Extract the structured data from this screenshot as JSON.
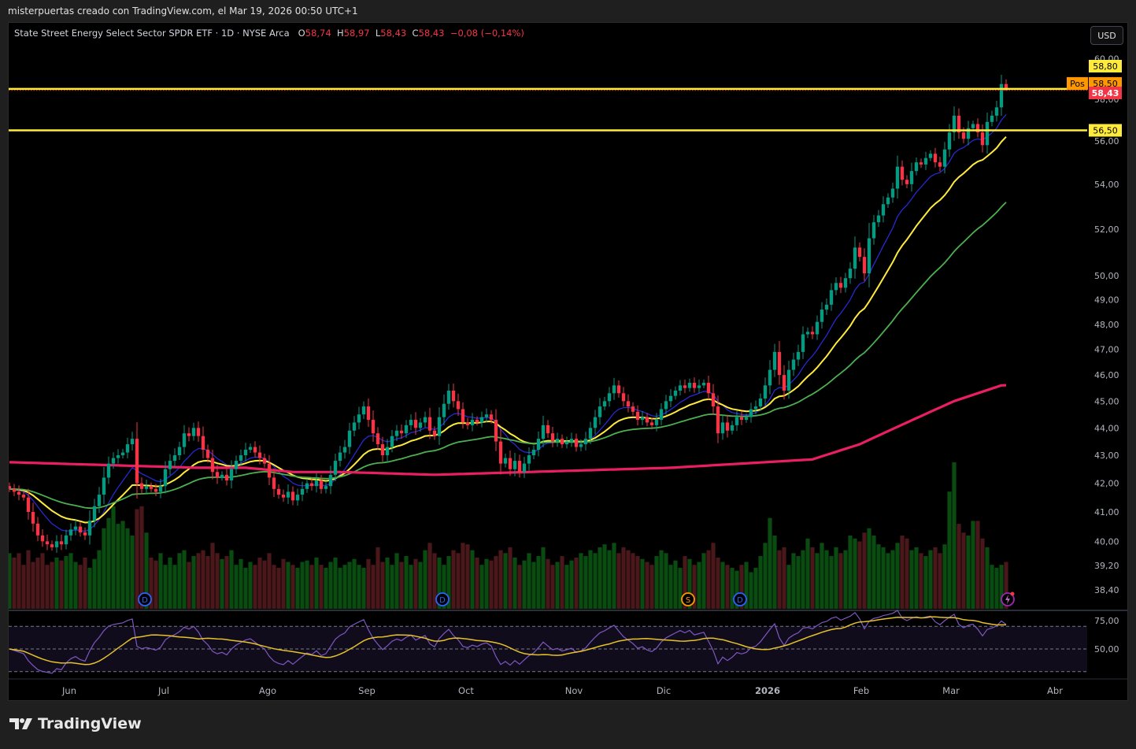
{
  "header": {
    "attribution": "misterpuertas creado con TradingView.com, el Mar 19, 2026 00:50 UTC+1"
  },
  "legend": {
    "symbol": "State Street Energy Select Sector SPDR ETF · 1D · NYSE Arca",
    "open_label": "O",
    "open": "58,74",
    "high_label": "H",
    "high": "58,97",
    "low_label": "L",
    "low": "58,43",
    "close_label": "C",
    "close": "58,43",
    "change": "−0,08 (−0,14%)"
  },
  "currency_button": "USD",
  "footer": {
    "brand": "TradingView"
  },
  "colors": {
    "up": "#089981",
    "down": "#f23645",
    "volume_up": "#0a4b12",
    "volume_down": "#4a171b",
    "ma_fast": "#2a2ae0",
    "ma_mid": "#ffeb3b",
    "ma_slow": "#4caf50",
    "ma_long": "#e91e63",
    "rsi": "#7e57c2",
    "rsi_ma": "#e6c229",
    "hline": "#ffeb3b",
    "position": "#ff9800"
  },
  "chart_data": {
    "type": "candlestick",
    "scale": "log",
    "interval": "1D",
    "x_tick_labels": [
      "Jun",
      "Jul",
      "Ago",
      "Sep",
      "Oct",
      "Nov",
      "Dic",
      "2026",
      "Feb",
      "Mar",
      "Abr"
    ],
    "y_tick_labels": [
      "60,00",
      "58,00",
      "56,00",
      "54,00",
      "52,00",
      "50,00",
      "49,00",
      "48,00",
      "47,00",
      "46,00",
      "45,00",
      "44,00",
      "43,00",
      "42,00",
      "41,00",
      "40,00",
      "39,20",
      "38,40"
    ],
    "y_ticks": [
      60,
      58,
      56,
      54,
      52,
      50,
      49,
      48,
      47,
      46,
      45,
      44,
      43,
      42,
      41,
      40,
      39.2,
      38.4
    ],
    "ylim": [
      38.4,
      60.5
    ],
    "last_candle": {
      "open": 58.74,
      "high": 58.97,
      "low": 58.43,
      "close": 58.43
    },
    "close": [
      41.8,
      41.7,
      41.6,
      41.5,
      41.0,
      40.6,
      40.2,
      40.0,
      39.9,
      39.8,
      40.0,
      39.9,
      40.2,
      40.4,
      40.5,
      40.3,
      40.2,
      40.7,
      41.2,
      41.6,
      42.2,
      42.7,
      42.9,
      43.0,
      43.1,
      43.4,
      43.6,
      42.0,
      41.8,
      41.9,
      41.8,
      41.7,
      41.9,
      42.5,
      42.8,
      43.0,
      43.3,
      43.8,
      43.7,
      44.0,
      43.7,
      43.2,
      42.9,
      42.4,
      42.2,
      42.3,
      42.1,
      42.5,
      42.8,
      43.0,
      43.2,
      43.3,
      43.1,
      42.9,
      42.7,
      42.2,
      41.8,
      41.6,
      41.5,
      41.7,
      41.4,
      41.6,
      41.8,
      42.0,
      41.9,
      42.1,
      41.8,
      41.9,
      42.3,
      42.8,
      43.1,
      43.3,
      43.9,
      44.2,
      44.5,
      44.8,
      44.3,
      43.8,
      43.4,
      43.0,
      43.3,
      43.7,
      43.9,
      43.8,
      44.1,
      44.3,
      44.0,
      44.2,
      44.4,
      43.9,
      43.7,
      44.4,
      44.9,
      45.4,
      45.0,
      44.7,
      44.2,
      44.1,
      44.3,
      44.2,
      44.4,
      44.5,
      44.3,
      43.5,
      42.7,
      42.9,
      42.5,
      42.8,
      42.4,
      42.7,
      43.0,
      43.2,
      43.6,
      44.1,
      43.8,
      43.5,
      43.6,
      43.4,
      43.5,
      43.6,
      43.3,
      43.4,
      43.6,
      44.0,
      44.4,
      44.8,
      45.0,
      45.3,
      45.6,
      45.3,
      45.0,
      44.8,
      44.6,
      44.3,
      44.4,
      44.2,
      44.1,
      44.3,
      44.7,
      45.0,
      45.2,
      45.4,
      45.6,
      45.5,
      45.7,
      45.5,
      45.6,
      45.7,
      45.3,
      44.8,
      43.8,
      44.2,
      43.9,
      44.1,
      44.4,
      44.3,
      44.4,
      44.7,
      44.8,
      45.1,
      45.6,
      46.2,
      46.9,
      46.0,
      45.4,
      46.2,
      46.6,
      46.9,
      47.6,
      47.7,
      47.6,
      48.1,
      48.6,
      48.8,
      49.4,
      49.7,
      49.5,
      49.9,
      50.3,
      51.2,
      50.8,
      50.1,
      51.6,
      52.3,
      52.6,
      53.1,
      53.4,
      53.8,
      54.8,
      54.2,
      54.0,
      54.6,
      55.0,
      54.9,
      55.2,
      55.4,
      55.0,
      54.8,
      55.6,
      56.4,
      57.2,
      56.4,
      56.1,
      56.6,
      56.8,
      56.4,
      55.8,
      56.9,
      57.2,
      57.6,
      58.74,
      58.43
    ],
    "volume": [
      38,
      35,
      38,
      30,
      40,
      32,
      35,
      38,
      30,
      32,
      35,
      33,
      36,
      38,
      32,
      30,
      35,
      28,
      34,
      40,
      55,
      62,
      70,
      58,
      60,
      55,
      50,
      68,
      70,
      52,
      35,
      33,
      38,
      30,
      35,
      30,
      38,
      40,
      32,
      36,
      38,
      40,
      36,
      45,
      38,
      34,
      36,
      40,
      30,
      34,
      28,
      32,
      30,
      35,
      33,
      38,
      30,
      28,
      34,
      32,
      30,
      28,
      32,
      33,
      30,
      35,
      30,
      28,
      32,
      35,
      28,
      30,
      32,
      34,
      30,
      28,
      34,
      30,
      42,
      32,
      35,
      30,
      38,
      32,
      36,
      30,
      34,
      32,
      40,
      45,
      38,
      35,
      30,
      36,
      40,
      38,
      45,
      44,
      40,
      35,
      30,
      34,
      33,
      36,
      40,
      38,
      42,
      35,
      30,
      33,
      38,
      32,
      36,
      42,
      34,
      30,
      32,
      36,
      30,
      33,
      35,
      38,
      36,
      40,
      38,
      42,
      44,
      40,
      45,
      38,
      42,
      40,
      38,
      36,
      34,
      32,
      30,
      36,
      40,
      38,
      30,
      33,
      28,
      36,
      34,
      30,
      32,
      38,
      40,
      45,
      35,
      32,
      30,
      28,
      26,
      30,
      32,
      25,
      28,
      36,
      45,
      62,
      50,
      40,
      42,
      30,
      38,
      36,
      40,
      48,
      42,
      38,
      45,
      40,
      36,
      42,
      38,
      40,
      50,
      48,
      46,
      52,
      55,
      50,
      44,
      42,
      38,
      40,
      45,
      50,
      48,
      40,
      42,
      38,
      36,
      40,
      42,
      38,
      44,
      80,
      100,
      58,
      52,
      50,
      60,
      60,
      48,
      42,
      30,
      28,
      30,
      32
    ],
    "moving_averages": [
      {
        "type": "EMA",
        "period": 10,
        "color": "#2a2ae0"
      },
      {
        "type": "EMA",
        "period": 20,
        "color": "#ffeb3b"
      },
      {
        "type": "EMA",
        "period": 50,
        "color": "#4caf50"
      },
      {
        "type": "SMA",
        "period": 200,
        "color": "#e91e63",
        "sampled_every_10": [
          42.75,
          42.7,
          42.65,
          42.6,
          42.55,
          42.55,
          42.4,
          42.4,
          42.35,
          42.3,
          42.35,
          42.4,
          42.45,
          42.5,
          42.55,
          42.65,
          42.75,
          42.85,
          43.4,
          44.2,
          45.0,
          45.6,
          45.67
        ]
      }
    ],
    "horizontal_lines": [
      {
        "price": 58.5,
        "label": "58,50",
        "tag": "Pos"
      },
      {
        "price": 56.5,
        "label": "56,50"
      }
    ],
    "price_labels": [
      {
        "price": 58.8,
        "label": "58,80",
        "kind": "alert"
      },
      {
        "price": 58.43,
        "label": "58,43",
        "kind": "last"
      }
    ],
    "events": [
      {
        "index": 27,
        "label": "D",
        "color": "#2962ff"
      },
      {
        "index": 90,
        "label": "D",
        "color": "#2962ff"
      },
      {
        "index": 142,
        "label": "S",
        "color": "#ff9800"
      },
      {
        "index": 153,
        "label": "D",
        "color": "#2962ff"
      }
    ],
    "rsi": {
      "period": 14,
      "ma_period": 14,
      "levels": [
        70,
        50,
        30
      ],
      "y_tick_labels": [
        "75,00",
        "50,00"
      ],
      "y_ticks": [
        75,
        50
      ]
    }
  }
}
